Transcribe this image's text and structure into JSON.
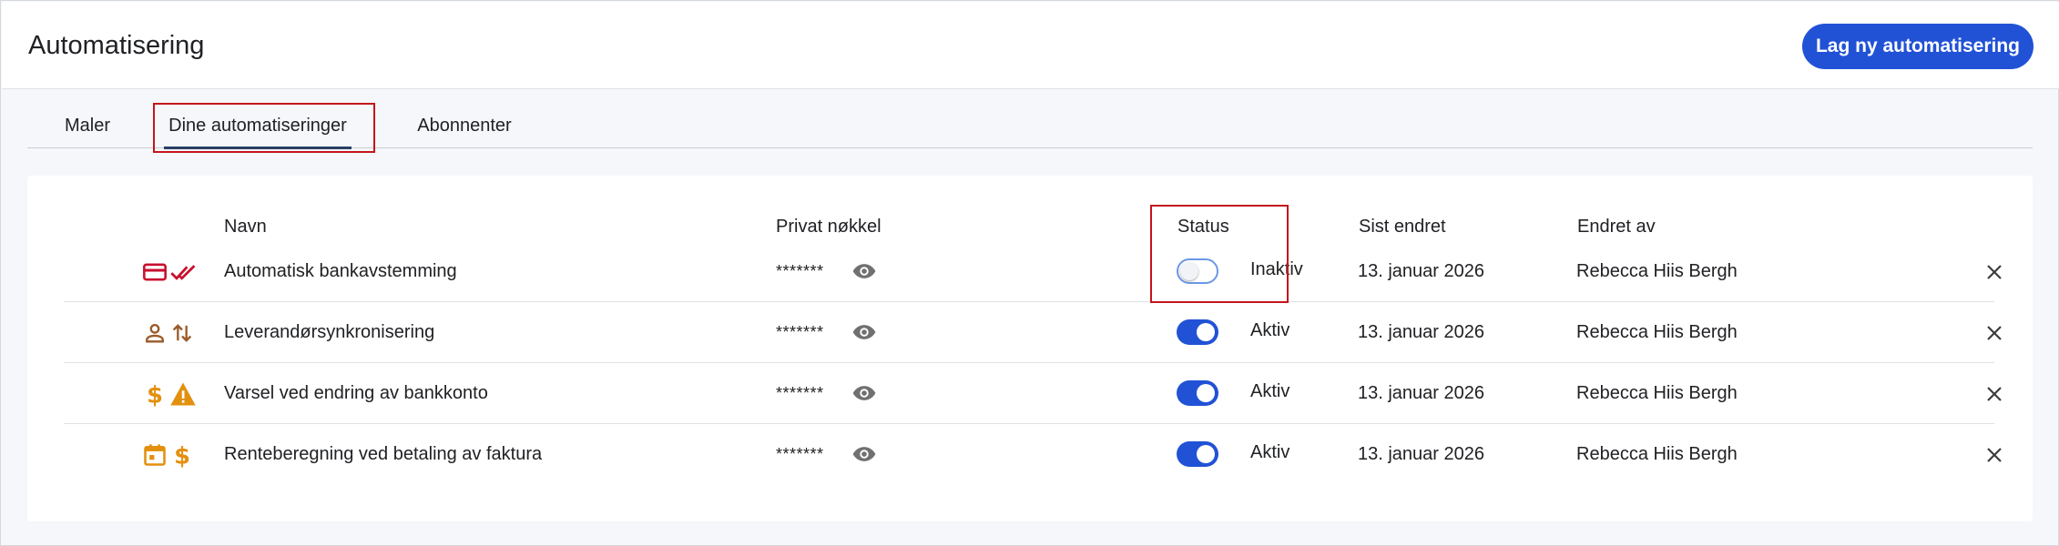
{
  "header": {
    "title": "Automatisering",
    "create_button": "Lag ny automatisering"
  },
  "tabs": [
    {
      "label": "Maler",
      "active": false
    },
    {
      "label": "Dine automatiseringer",
      "active": true
    },
    {
      "label": "Abonnenter",
      "active": false
    }
  ],
  "table": {
    "columns": {
      "name": "Navn",
      "private_key": "Privat nøkkel",
      "status": "Status",
      "last_changed": "Sist endret",
      "changed_by": "Endret av"
    },
    "rows": [
      {
        "icons": [
          "credit-card-icon",
          "double-check-icon"
        ],
        "name": "Automatisk bankavstemming",
        "key_mask": "*******",
        "status_on": false,
        "status_label": "Inaktiv",
        "date": "13. januar 2026",
        "editor": "Rebecca Hiis Bergh"
      },
      {
        "icons": [
          "person-icon",
          "swap-vertical-icon"
        ],
        "name": "Leverandørsynkronisering",
        "key_mask": "*******",
        "status_on": true,
        "status_label": "Aktiv",
        "date": "13. januar 2026",
        "editor": "Rebecca Hiis Bergh"
      },
      {
        "icons": [
          "dollar-icon",
          "warning-icon"
        ],
        "name": "Varsel ved endring av bankkonto",
        "key_mask": "*******",
        "status_on": true,
        "status_label": "Aktiv",
        "date": "13. januar 2026",
        "editor": "Rebecca Hiis Bergh"
      },
      {
        "icons": [
          "calendar-icon",
          "dollar-icon"
        ],
        "name": "Renteberegning ved betaling av faktura",
        "key_mask": "*******",
        "status_on": true,
        "status_label": "Aktiv",
        "date": "13. januar 2026",
        "editor": "Rebecca Hiis Bergh"
      }
    ]
  },
  "colors": {
    "primary": "#2152d6",
    "highlight_border": "#c4161c",
    "icon_red": "#c8102e",
    "icon_brown": "#9a5a2a",
    "icon_orange": "#e3900f"
  }
}
